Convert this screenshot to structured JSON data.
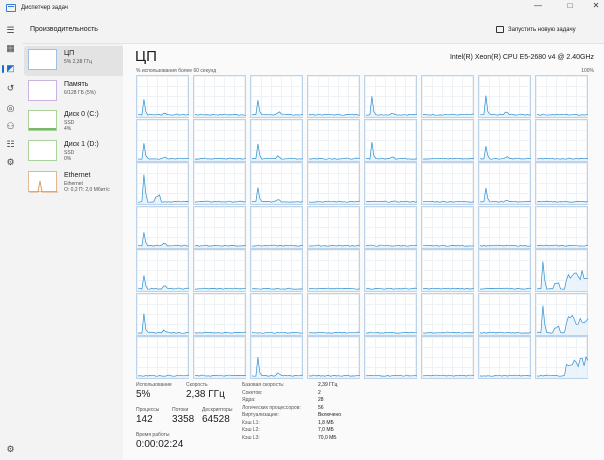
{
  "window": {
    "title": "Диспетчер задач"
  },
  "rail": {
    "icons": [
      "hamburger-icon",
      "processes-icon",
      "performance-icon",
      "history-icon",
      "startup-icon",
      "users-icon",
      "details-icon",
      "services-icon",
      "settings-icon"
    ]
  },
  "header": {
    "title": "Производительность",
    "run_task_label": "Запустить новую задачу",
    "more_label": "..."
  },
  "resources": [
    {
      "name": "ЦП",
      "sub1": "5% 2,38 ГГц",
      "sub2": ""
    },
    {
      "name": "Память",
      "sub1": "6/128 ГБ (5%)",
      "sub2": ""
    },
    {
      "name": "Диск 0 (C:)",
      "sub1": "SSD",
      "sub2": "4%"
    },
    {
      "name": "Диск 1 (D:)",
      "sub1": "SSD",
      "sub2": "0%"
    },
    {
      "name": "Ethernet",
      "sub1": "Ethernet",
      "sub2": "О: 0,2 П: 2,0 Мбит/с"
    }
  ],
  "cpu": {
    "title": "ЦП",
    "model": "Intel(R) Xeon(R) CPU E5-2680 v4 @ 2.40GHz",
    "usage_caption": "% использования более 60 секунд",
    "max_label": "100%",
    "colors": {
      "line": "#2f8fd0",
      "fill": "#e6f1fa",
      "border": "#bcd3ea"
    },
    "logical_processor_count": 56,
    "cell_profiles": [
      [
        1,
        0,
        1,
        0,
        1,
        0,
        1,
        0
      ],
      [
        1,
        0,
        1,
        0,
        1,
        0,
        1,
        0
      ],
      [
        2,
        0,
        1,
        0,
        0,
        0,
        1,
        0
      ],
      [
        1,
        0,
        0,
        0,
        0,
        0,
        0,
        0
      ],
      [
        1,
        0,
        0,
        0,
        0,
        0,
        0,
        2
      ],
      [
        1,
        0,
        0,
        0,
        0,
        0,
        0,
        2
      ],
      [
        0,
        0,
        1,
        0,
        0,
        0,
        0,
        0
      ]
    ]
  },
  "stats": {
    "usage_label": "Использование",
    "usage_val": "5%",
    "speed_label": "Скорость",
    "speed_val": "2,38 ГГц",
    "processes_label": "Процессы",
    "processes_val": "142",
    "threads_label": "Потоки",
    "threads_val": "3358",
    "handles_label": "Дескрипторы",
    "handles_val": "64528",
    "uptime_label": "Время работы",
    "uptime_val": "0:00:02:24"
  },
  "specs": [
    {
      "label": "Базовая скорость:",
      "value": "2,39 ГГц"
    },
    {
      "label": "Сокетов:",
      "value": "2"
    },
    {
      "label": "Ядра:",
      "value": "28"
    },
    {
      "label": "Логических процессоров:",
      "value": "56"
    },
    {
      "label": "Виртуализация:",
      "value": "Включено"
    },
    {
      "label": "Кэш L1:",
      "value": "1,8 МБ"
    },
    {
      "label": "Кэш L2:",
      "value": "7,0 МБ"
    },
    {
      "label": "Кэш L3:",
      "value": "70,0 МБ"
    }
  ]
}
